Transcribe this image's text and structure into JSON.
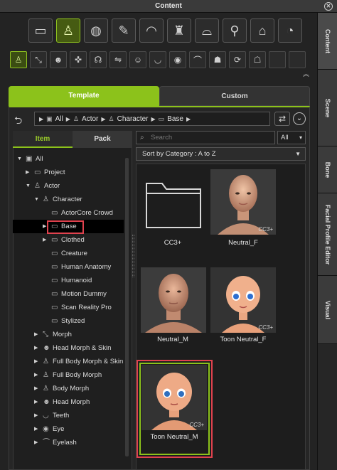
{
  "window": {
    "title": "Content",
    "close_icon": "close-icon"
  },
  "side_tabs": [
    "Content",
    "Scene",
    "Bone",
    "Facial Profile Editor",
    "Visual"
  ],
  "category_icons": [
    {
      "name": "folder-icon",
      "glyph": "▭",
      "active": false
    },
    {
      "name": "actor-icon",
      "glyph": "♙",
      "active": true
    },
    {
      "name": "material-icon",
      "glyph": "◍",
      "active": false
    },
    {
      "name": "makeup-icon",
      "glyph": "✎",
      "active": false
    },
    {
      "name": "hair-icon",
      "glyph": "◠",
      "active": false
    },
    {
      "name": "cloth-icon",
      "glyph": "♜",
      "active": false
    },
    {
      "name": "accessory-icon",
      "glyph": "⌓",
      "active": false
    },
    {
      "name": "prop-icon",
      "glyph": "⚲",
      "active": false
    },
    {
      "name": "stage-icon",
      "glyph": "⌂",
      "active": false
    },
    {
      "name": "chart-icon",
      "glyph": "◔",
      "active": false
    }
  ],
  "sub_icons": [
    {
      "name": "body-icon",
      "glyph": "♙",
      "active": true
    },
    {
      "name": "morph-icon",
      "glyph": "⤡",
      "active": false
    },
    {
      "name": "head-icon",
      "glyph": "☻",
      "active": false
    },
    {
      "name": "skeleton-icon",
      "glyph": "✜",
      "active": false
    },
    {
      "name": "pose-icon",
      "glyph": "☊",
      "active": false
    },
    {
      "name": "motion-icon",
      "glyph": "⇋",
      "active": false
    },
    {
      "name": "face-icon",
      "glyph": "☺",
      "active": false
    },
    {
      "name": "mouth-icon",
      "glyph": "◡",
      "active": false
    },
    {
      "name": "eye-icon",
      "glyph": "◉",
      "active": false
    },
    {
      "name": "eyelash-icon",
      "glyph": "⌒",
      "active": false
    },
    {
      "name": "avatar-icon",
      "glyph": "☗",
      "active": false
    },
    {
      "name": "refresh-head-icon",
      "glyph": "⟳",
      "active": false
    },
    {
      "name": "user-icon",
      "glyph": "☖",
      "active": false
    },
    {
      "name": "empty-slot-1",
      "glyph": "",
      "active": false
    },
    {
      "name": "empty-slot-2",
      "glyph": "",
      "active": false
    }
  ],
  "tabs": {
    "template": "Template",
    "custom": "Custom"
  },
  "path": {
    "items": [
      "All",
      "Actor",
      "Character",
      "Base"
    ]
  },
  "subtabs": {
    "item": "Item",
    "pack": "Pack"
  },
  "tree": [
    {
      "label": "All",
      "level": 0,
      "arrow": "▼",
      "icon": "▣"
    },
    {
      "label": "Project",
      "level": 1,
      "arrow": "▶",
      "icon": "▭"
    },
    {
      "label": "Actor",
      "level": 1,
      "arrow": "▼",
      "icon": "♙"
    },
    {
      "label": "Character",
      "level": 2,
      "arrow": "▼",
      "icon": "♙"
    },
    {
      "label": "ActorCore Crowd",
      "level": 3,
      "arrow": "",
      "icon": "▭"
    },
    {
      "label": "Base",
      "level": 3,
      "arrow": "▶",
      "icon": "▭",
      "selected": true
    },
    {
      "label": "Clothed",
      "level": 3,
      "arrow": "▶",
      "icon": "▭"
    },
    {
      "label": "Creature",
      "level": 3,
      "arrow": "",
      "icon": "▭"
    },
    {
      "label": "Human Anatomy",
      "level": 3,
      "arrow": "",
      "icon": "▭"
    },
    {
      "label": "Humanoid",
      "level": 3,
      "arrow": "",
      "icon": "▭"
    },
    {
      "label": "Motion Dummy",
      "level": 3,
      "arrow": "",
      "icon": "▭"
    },
    {
      "label": "Scan Reality Pro",
      "level": 3,
      "arrow": "",
      "icon": "▭"
    },
    {
      "label": "Stylized",
      "level": 3,
      "arrow": "",
      "icon": "▭"
    },
    {
      "label": "Morph",
      "level": 2,
      "arrow": "▶",
      "icon": "⤡"
    },
    {
      "label": "Head Morph & Skin",
      "level": 2,
      "arrow": "▶",
      "icon": "☻"
    },
    {
      "label": "Full Body Morph & Skin",
      "level": 2,
      "arrow": "▶",
      "icon": "♙"
    },
    {
      "label": "Full Body Morph",
      "level": 2,
      "arrow": "▶",
      "icon": "♙"
    },
    {
      "label": "Body Morph",
      "level": 2,
      "arrow": "▶",
      "icon": "♙"
    },
    {
      "label": "Head Morph",
      "level": 2,
      "arrow": "▶",
      "icon": "☻"
    },
    {
      "label": "Teeth",
      "level": 2,
      "arrow": "▶",
      "icon": "◡"
    },
    {
      "label": "Eye",
      "level": 2,
      "arrow": "▶",
      "icon": "◉"
    },
    {
      "label": "Eyelash",
      "level": 2,
      "arrow": "▶",
      "icon": "⌒"
    }
  ],
  "search": {
    "placeholder": "Search",
    "filter": "All"
  },
  "sort": {
    "label": "Sort by Category : A to Z"
  },
  "items": [
    {
      "label": "CC3+",
      "kind": "folder"
    },
    {
      "label": "Neutral_F",
      "kind": "female"
    },
    {
      "label": "Neutral_M",
      "kind": "male"
    },
    {
      "label": "Toon Neutral_F",
      "kind": "toon-f"
    },
    {
      "label": "Toon Neutral_M",
      "kind": "toon-m",
      "selected": true
    }
  ],
  "badge": "CC3+",
  "colors": {
    "accent": "#8cc21b",
    "highlight": "#e0424e"
  }
}
